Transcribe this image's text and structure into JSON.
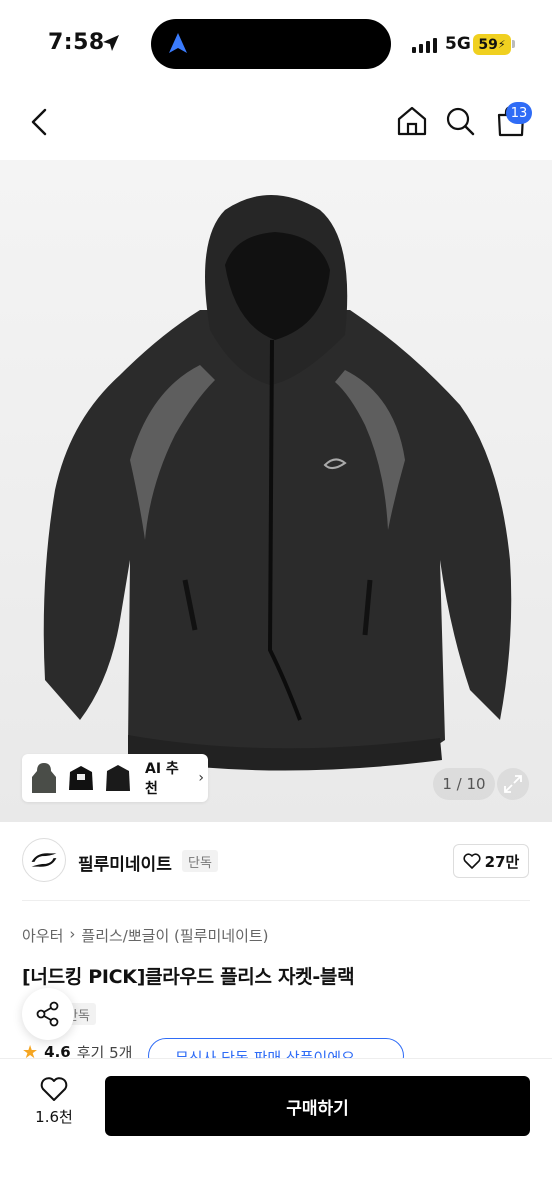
{
  "status": {
    "time": "7:58",
    "network": "5G",
    "battery": "59"
  },
  "header": {
    "cart_badge": "13"
  },
  "gallery": {
    "counter": "1 / 10",
    "ai_label": "AI 추천"
  },
  "brand": {
    "name": "필루미네이트",
    "badge": "단독",
    "likes": "27만"
  },
  "product": {
    "breadcrumb": [
      "아우터",
      "플리스/뽀글이 (필루미네이트)"
    ],
    "title": "[너드킹 PICK]클라우드 플리스 자켓-블랙",
    "badge": "단독",
    "rating": "4.6",
    "reviews": "후기 5개",
    "notice": "무신사 단독 판매 상품이에요"
  },
  "bottom": {
    "wish_count": "1.6천",
    "buy_label": "구매하기"
  },
  "colors": {
    "accent": "#2f6cf6",
    "buy_button": "#000000",
    "star": "#f5a623"
  }
}
